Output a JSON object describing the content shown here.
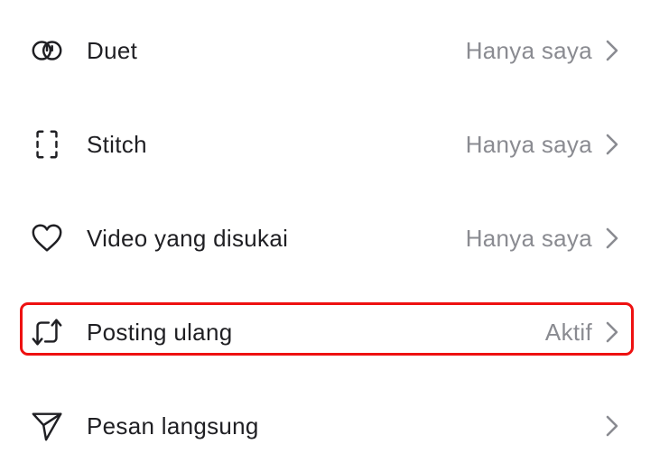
{
  "highlight_color": "#ee1111",
  "items": [
    {
      "icon": "duet-icon",
      "label": "Duet",
      "value": "Hanya saya"
    },
    {
      "icon": "stitch-icon",
      "label": "Stitch",
      "value": "Hanya saya"
    },
    {
      "icon": "heart-icon",
      "label": "Video yang disukai",
      "value": "Hanya saya"
    },
    {
      "icon": "repost-icon",
      "label": "Posting ulang",
      "value": "Aktif"
    },
    {
      "icon": "send-icon",
      "label": "Pesan langsung",
      "value": ""
    }
  ]
}
